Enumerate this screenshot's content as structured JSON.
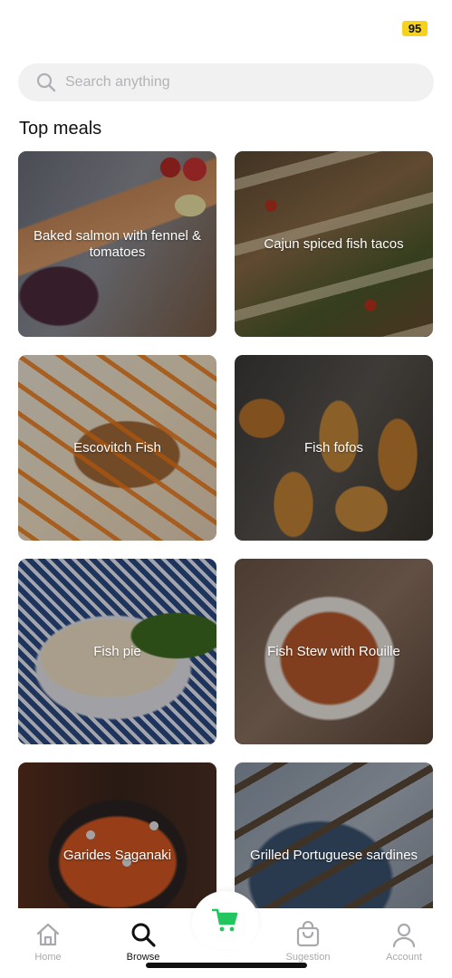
{
  "status": {
    "badge": "95",
    "badge_color": "#f4d21e"
  },
  "search": {
    "placeholder": "Search anything",
    "icon": "search-icon"
  },
  "section": {
    "title": "Top meals"
  },
  "meals": [
    {
      "name": "Baked salmon with fennel & tomatoes"
    },
    {
      "name": "Cajun spiced fish tacos"
    },
    {
      "name": "Escovitch Fish"
    },
    {
      "name": "Fish fofos"
    },
    {
      "name": "Fish pie"
    },
    {
      "name": "Fish Stew with Rouille"
    },
    {
      "name": "Garides Saganaki"
    },
    {
      "name": "Grilled Portuguese sardines"
    }
  ],
  "nav": {
    "items": [
      {
        "label": "Home",
        "icon": "home-icon",
        "active": false
      },
      {
        "label": "Browse",
        "icon": "search-icon",
        "active": true
      },
      {
        "label": "Sugestion",
        "icon": "shopping-bag-icon",
        "active": false
      },
      {
        "label": "Account",
        "icon": "user-icon",
        "active": false
      }
    ],
    "cart_icon": "cart-icon",
    "accent_color": "#22c55e"
  }
}
